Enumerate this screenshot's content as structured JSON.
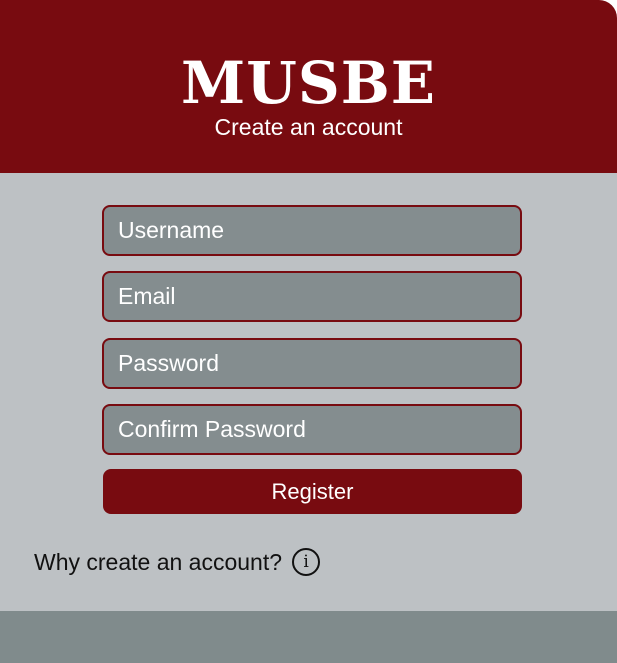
{
  "header": {
    "brand": "MUSBE",
    "subtitle": "Create an account"
  },
  "form": {
    "username_placeholder": "Username",
    "email_placeholder": "Email",
    "password_placeholder": "Password",
    "confirm_password_placeholder": "Confirm Password",
    "register_label": "Register"
  },
  "help": {
    "text": "Why create an account?",
    "icon": "info-icon",
    "icon_glyph": "i"
  },
  "colors": {
    "brand": "#780b10",
    "panel": "#bdc1c4",
    "field": "#848d8f",
    "footer": "#808b8c"
  }
}
